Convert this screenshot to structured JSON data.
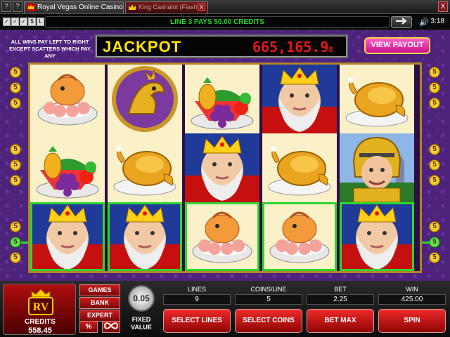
{
  "titlebar": {
    "sys_buttons": [
      "?",
      "?"
    ],
    "tab_active": "Royal Vegas Online Casino",
    "tab_inactive": "King Cashalot (Flash)",
    "close_glyph": "X"
  },
  "infobar": {
    "message": "LINE 3 PAYS 50.00 CREDITS",
    "time": "3:18",
    "tools": [
      "✓",
      "✓",
      "✓",
      "$",
      "L"
    ]
  },
  "game": {
    "rule_text": "ALL WINS PAY LEFT TO RIGHT EXCEPT SCATTERS WHICH PAY ANY",
    "jackpot_label": "JACKPOT",
    "jackpot_value": "665,165.9",
    "jackpot_suffix": "8",
    "view_payout": "VIEW PAYOUT",
    "line_number": "5",
    "reels": [
      [
        "shrimp",
        "fruit",
        "king"
      ],
      [
        "dragon",
        "chicken",
        "king"
      ],
      [
        "fruit",
        "king",
        "shrimp"
      ],
      [
        "king",
        "chicken",
        "shrimp"
      ],
      [
        "chicken",
        "knight",
        "king"
      ]
    ],
    "highlight_row": 2,
    "highlight_color": "#2fd62f"
  },
  "panel": {
    "credits_label": "CREDITS",
    "credits_value": "558.45",
    "logo_text": "RV",
    "menu": [
      "GAMES",
      "BANK",
      "EXPERT"
    ],
    "pct": "%",
    "chip_value": "0.05",
    "fixed_value": "FIXED VALUE",
    "stats": [
      {
        "label": "LINES",
        "value": "9"
      },
      {
        "label": "COINS/LINE",
        "value": "5"
      },
      {
        "label": "BET",
        "value": "2.25"
      },
      {
        "label": "WIN",
        "value": "425.00"
      }
    ],
    "buttons": [
      "SELECT LINES",
      "SELECT COINS",
      "BET MAX",
      "SPIN"
    ]
  }
}
